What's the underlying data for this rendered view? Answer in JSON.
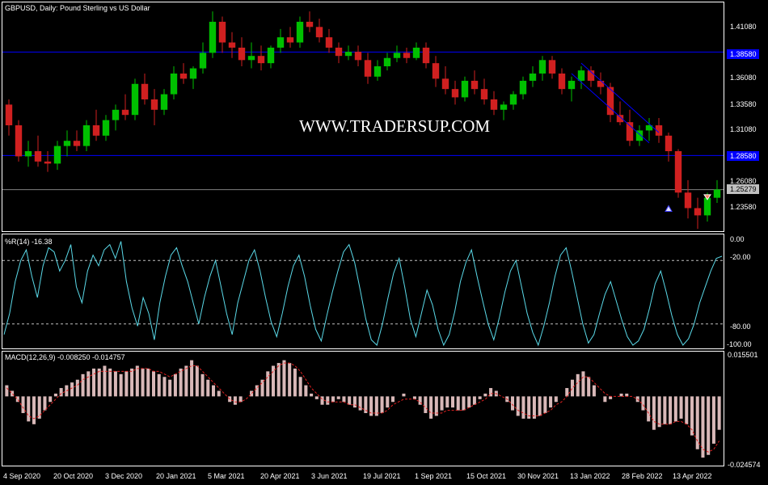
{
  "chart_data": {
    "type": "candlestick",
    "price_panel": {
      "title": "GBPUSD, Daily:  Pound Sterling vs US Dollar",
      "price_ticks": [
        "1.41080",
        "1.38580",
        "1.36080",
        "1.33580",
        "1.31080",
        "1.28580",
        "1.26080",
        "1.23580"
      ],
      "horizontal_levels": [
        {
          "label": "1.38580",
          "value": 1.3858,
          "color": "#0000ff"
        },
        {
          "label": "1.28580",
          "value": 1.2858,
          "color": "#0000ff"
        }
      ],
      "current_price": {
        "label": "1.25279",
        "value": 1.25279
      },
      "watermark": "WWW.TRADERSUP.COM",
      "ylim": [
        1.2135,
        1.4329
      ],
      "candles": [
        {
          "o": 1.335,
          "h": 1.34,
          "l": 1.305,
          "c": 1.315
        },
        {
          "o": 1.315,
          "h": 1.32,
          "l": 1.28,
          "c": 1.285
        },
        {
          "o": 1.285,
          "h": 1.3,
          "l": 1.275,
          "c": 1.29
        },
        {
          "o": 1.29,
          "h": 1.305,
          "l": 1.275,
          "c": 1.28
        },
        {
          "o": 1.28,
          "h": 1.29,
          "l": 1.27,
          "c": 1.278
        },
        {
          "o": 1.278,
          "h": 1.3,
          "l": 1.272,
          "c": 1.295
        },
        {
          "o": 1.295,
          "h": 1.31,
          "l": 1.285,
          "c": 1.3
        },
        {
          "o": 1.3,
          "h": 1.31,
          "l": 1.29,
          "c": 1.295
        },
        {
          "o": 1.295,
          "h": 1.32,
          "l": 1.29,
          "c": 1.315
        },
        {
          "o": 1.315,
          "h": 1.33,
          "l": 1.3,
          "c": 1.305
        },
        {
          "o": 1.305,
          "h": 1.325,
          "l": 1.3,
          "c": 1.32
        },
        {
          "o": 1.32,
          "h": 1.335,
          "l": 1.31,
          "c": 1.33
        },
        {
          "o": 1.33,
          "h": 1.345,
          "l": 1.32,
          "c": 1.325
        },
        {
          "o": 1.325,
          "h": 1.36,
          "l": 1.32,
          "c": 1.355
        },
        {
          "o": 1.355,
          "h": 1.365,
          "l": 1.335,
          "c": 1.34
        },
        {
          "o": 1.34,
          "h": 1.35,
          "l": 1.315,
          "c": 1.33
        },
        {
          "o": 1.33,
          "h": 1.35,
          "l": 1.325,
          "c": 1.345
        },
        {
          "o": 1.345,
          "h": 1.372,
          "l": 1.34,
          "c": 1.365
        },
        {
          "o": 1.365,
          "h": 1.375,
          "l": 1.355,
          "c": 1.36
        },
        {
          "o": 1.36,
          "h": 1.372,
          "l": 1.35,
          "c": 1.37
        },
        {
          "o": 1.37,
          "h": 1.395,
          "l": 1.365,
          "c": 1.385
        },
        {
          "o": 1.385,
          "h": 1.425,
          "l": 1.38,
          "c": 1.415
        },
        {
          "o": 1.415,
          "h": 1.42,
          "l": 1.385,
          "c": 1.395
        },
        {
          "o": 1.395,
          "h": 1.405,
          "l": 1.38,
          "c": 1.39
        },
        {
          "o": 1.39,
          "h": 1.4,
          "l": 1.372,
          "c": 1.378
        },
        {
          "o": 1.378,
          "h": 1.395,
          "l": 1.37,
          "c": 1.382
        },
        {
          "o": 1.382,
          "h": 1.392,
          "l": 1.368,
          "c": 1.375
        },
        {
          "o": 1.375,
          "h": 1.392,
          "l": 1.37,
          "c": 1.39
        },
        {
          "o": 1.39,
          "h": 1.408,
          "l": 1.385,
          "c": 1.4
        },
        {
          "o": 1.4,
          "h": 1.41,
          "l": 1.39,
          "c": 1.395
        },
        {
          "o": 1.395,
          "h": 1.42,
          "l": 1.39,
          "c": 1.415
        },
        {
          "o": 1.415,
          "h": 1.425,
          "l": 1.405,
          "c": 1.41
        },
        {
          "o": 1.41,
          "h": 1.418,
          "l": 1.395,
          "c": 1.4
        },
        {
          "o": 1.4,
          "h": 1.408,
          "l": 1.385,
          "c": 1.39
        },
        {
          "o": 1.39,
          "h": 1.395,
          "l": 1.375,
          "c": 1.382
        },
        {
          "o": 1.382,
          "h": 1.392,
          "l": 1.378,
          "c": 1.386
        },
        {
          "o": 1.386,
          "h": 1.392,
          "l": 1.372,
          "c": 1.378
        },
        {
          "o": 1.378,
          "h": 1.385,
          "l": 1.355,
          "c": 1.362
        },
        {
          "o": 1.362,
          "h": 1.378,
          "l": 1.358,
          "c": 1.372
        },
        {
          "o": 1.372,
          "h": 1.385,
          "l": 1.368,
          "c": 1.38
        },
        {
          "o": 1.38,
          "h": 1.392,
          "l": 1.376,
          "c": 1.385
        },
        {
          "o": 1.385,
          "h": 1.39,
          "l": 1.375,
          "c": 1.38
        },
        {
          "o": 1.38,
          "h": 1.395,
          "l": 1.378,
          "c": 1.39
        },
        {
          "o": 1.39,
          "h": 1.395,
          "l": 1.37,
          "c": 1.375
        },
        {
          "o": 1.375,
          "h": 1.382,
          "l": 1.352,
          "c": 1.36
        },
        {
          "o": 1.36,
          "h": 1.372,
          "l": 1.345,
          "c": 1.35
        },
        {
          "o": 1.35,
          "h": 1.358,
          "l": 1.335,
          "c": 1.342
        },
        {
          "o": 1.342,
          "h": 1.362,
          "l": 1.338,
          "c": 1.358
        },
        {
          "o": 1.358,
          "h": 1.368,
          "l": 1.345,
          "c": 1.35
        },
        {
          "o": 1.35,
          "h": 1.36,
          "l": 1.335,
          "c": 1.34
        },
        {
          "o": 1.34,
          "h": 1.348,
          "l": 1.325,
          "c": 1.33
        },
        {
          "o": 1.33,
          "h": 1.338,
          "l": 1.32,
          "c": 1.335
        },
        {
          "o": 1.335,
          "h": 1.348,
          "l": 1.33,
          "c": 1.345
        },
        {
          "o": 1.345,
          "h": 1.362,
          "l": 1.34,
          "c": 1.358
        },
        {
          "o": 1.358,
          "h": 1.372,
          "l": 1.352,
          "c": 1.365
        },
        {
          "o": 1.365,
          "h": 1.382,
          "l": 1.358,
          "c": 1.378
        },
        {
          "o": 1.378,
          "h": 1.382,
          "l": 1.36,
          "c": 1.365
        },
        {
          "o": 1.365,
          "h": 1.37,
          "l": 1.345,
          "c": 1.35
        },
        {
          "o": 1.35,
          "h": 1.362,
          "l": 1.338,
          "c": 1.358
        },
        {
          "o": 1.358,
          "h": 1.372,
          "l": 1.35,
          "c": 1.368
        },
        {
          "o": 1.368,
          "h": 1.372,
          "l": 1.352,
          "c": 1.358
        },
        {
          "o": 1.358,
          "h": 1.366,
          "l": 1.345,
          "c": 1.352
        },
        {
          "o": 1.352,
          "h": 1.356,
          "l": 1.318,
          "c": 1.325
        },
        {
          "o": 1.325,
          "h": 1.338,
          "l": 1.315,
          "c": 1.318
        },
        {
          "o": 1.318,
          "h": 1.33,
          "l": 1.295,
          "c": 1.3
        },
        {
          "o": 1.3,
          "h": 1.315,
          "l": 1.295,
          "c": 1.31
        },
        {
          "o": 1.31,
          "h": 1.322,
          "l": 1.3,
          "c": 1.315
        },
        {
          "o": 1.315,
          "h": 1.322,
          "l": 1.298,
          "c": 1.305
        },
        {
          "o": 1.305,
          "h": 1.308,
          "l": 1.28,
          "c": 1.29
        },
        {
          "o": 1.29,
          "h": 1.292,
          "l": 1.245,
          "c": 1.25
        },
        {
          "o": 1.25,
          "h": 1.262,
          "l": 1.225,
          "c": 1.235
        },
        {
          "o": 1.235,
          "h": 1.245,
          "l": 1.215,
          "c": 1.228
        },
        {
          "o": 1.228,
          "h": 1.25,
          "l": 1.222,
          "c": 1.245
        },
        {
          "o": 1.245,
          "h": 1.262,
          "l": 1.24,
          "c": 1.253
        }
      ]
    },
    "williams_r": {
      "label": "%R(14) -16.38",
      "axis_labels": [
        "0.00",
        "-20.00",
        "-80.00",
        "-100.00"
      ],
      "levels": [
        -20,
        -80
      ],
      "ylim": [
        -100,
        0
      ],
      "values": [
        -90,
        -70,
        -40,
        -20,
        -10,
        -35,
        -55,
        -25,
        -8,
        -12,
        -30,
        -20,
        -5,
        -45,
        -60,
        -30,
        -15,
        -25,
        -10,
        -5,
        -18,
        -2,
        -40,
        -65,
        -82,
        -55,
        -70,
        -95,
        -60,
        -35,
        -15,
        -8,
        -25,
        -40,
        -60,
        -80,
        -55,
        -35,
        -20,
        -45,
        -70,
        -90,
        -60,
        -40,
        -20,
        -10,
        -30,
        -55,
        -78,
        -92,
        -70,
        -45,
        -25,
        -15,
        -35,
        -62,
        -85,
        -96,
        -72,
        -50,
        -30,
        -12,
        -5,
        -22,
        -48,
        -75,
        -95,
        -100,
        -80,
        -55,
        -32,
        -18,
        -45,
        -75,
        -92,
        -70,
        -48,
        -62,
        -85,
        -100,
        -90,
        -68,
        -40,
        -22,
        -10,
        -35,
        -58,
        -80,
        -95,
        -74,
        -50,
        -30,
        -20,
        -45,
        -70,
        -88,
        -100,
        -82,
        -60,
        -35,
        -15,
        -8,
        -30,
        -55,
        -80,
        -98,
        -90,
        -70,
        -52,
        -40,
        -58,
        -76,
        -92,
        -100,
        -96,
        -85,
        -65,
        -42,
        -30,
        -50,
        -72,
        -90,
        -100,
        -94,
        -80,
        -60,
        -45,
        -30,
        -18,
        -16
      ]
    },
    "macd": {
      "label": "MACD(12,26,9) -0.008250 -0.014757",
      "axis_labels": [
        "0.015501",
        "-0.024574"
      ],
      "ylim": [
        -0.024574,
        0.015501
      ],
      "histogram": [
        0.004,
        0.002,
        -0.002,
        -0.006,
        -0.009,
        -0.01,
        -0.008,
        -0.005,
        -0.002,
        0.001,
        0.003,
        0.004,
        0.005,
        0.006,
        0.008,
        0.009,
        0.01,
        0.01,
        0.011,
        0.01,
        0.009,
        0.008,
        0.009,
        0.01,
        0.011,
        0.01,
        0.01,
        0.009,
        0.008,
        0.007,
        0.006,
        0.008,
        0.01,
        0.011,
        0.013,
        0.011,
        0.008,
        0.006,
        0.004,
        0.002,
        0.0,
        -0.002,
        -0.003,
        -0.002,
        0.0,
        0.002,
        0.004,
        0.006,
        0.009,
        0.011,
        0.012,
        0.013,
        0.012,
        0.01,
        0.007,
        0.004,
        0.001,
        -0.001,
        -0.003,
        -0.003,
        -0.002,
        -0.001,
        -0.002,
        -0.003,
        -0.004,
        -0.005,
        -0.006,
        -0.007,
        -0.007,
        -0.006,
        -0.004,
        -0.002,
        0.0,
        0.001,
        0.0,
        -0.001,
        -0.003,
        -0.006,
        -0.008,
        -0.007,
        -0.005,
        -0.004,
        -0.004,
        -0.005,
        -0.005,
        -0.004,
        -0.003,
        -0.001,
        0.001,
        0.003,
        0.002,
        0.0,
        -0.002,
        -0.005,
        -0.007,
        -0.008,
        -0.008,
        -0.008,
        -0.007,
        -0.006,
        -0.004,
        -0.002,
        0.0,
        0.003,
        0.006,
        0.008,
        0.009,
        0.007,
        0.004,
        0.0,
        -0.002,
        -0.001,
        0.0,
        0.001,
        0.001,
        0.0,
        -0.002,
        -0.005,
        -0.009,
        -0.012,
        -0.011,
        -0.01,
        -0.01,
        -0.009,
        -0.008,
        -0.01,
        -0.014,
        -0.019,
        -0.022,
        -0.021,
        -0.017,
        -0.012
      ],
      "signal": [
        0.003,
        0.001,
        -0.001,
        -0.004,
        -0.007,
        -0.008,
        -0.007,
        -0.005,
        -0.003,
        -0.001,
        0.001,
        0.002,
        0.003,
        0.004,
        0.006,
        0.007,
        0.008,
        0.009,
        0.009,
        0.009,
        0.009,
        0.009,
        0.009,
        0.009,
        0.01,
        0.01,
        0.01,
        0.009,
        0.009,
        0.008,
        0.007,
        0.008,
        0.009,
        0.01,
        0.011,
        0.011,
        0.009,
        0.007,
        0.005,
        0.003,
        0.001,
        -0.001,
        -0.002,
        -0.002,
        -0.001,
        0.001,
        0.003,
        0.005,
        0.007,
        0.009,
        0.011,
        0.012,
        0.012,
        0.011,
        0.009,
        0.006,
        0.003,
        0.001,
        -0.001,
        -0.002,
        -0.002,
        -0.002,
        -0.002,
        -0.003,
        -0.003,
        -0.004,
        -0.005,
        -0.006,
        -0.006,
        -0.006,
        -0.005,
        -0.003,
        -0.002,
        -0.001,
        -0.001,
        -0.001,
        -0.002,
        -0.004,
        -0.006,
        -0.006,
        -0.006,
        -0.005,
        -0.005,
        -0.005,
        -0.005,
        -0.004,
        -0.003,
        -0.002,
        -0.001,
        0.001,
        0.001,
        0.0,
        -0.001,
        -0.003,
        -0.005,
        -0.006,
        -0.007,
        -0.007,
        -0.007,
        -0.006,
        -0.005,
        -0.003,
        -0.002,
        0.0,
        0.003,
        0.005,
        0.007,
        0.007,
        0.005,
        0.003,
        0.001,
        0.0,
        0.0,
        0.0,
        0.0,
        0.0,
        -0.001,
        -0.003,
        -0.006,
        -0.009,
        -0.01,
        -0.01,
        -0.01,
        -0.009,
        -0.009,
        -0.01,
        -0.012,
        -0.016,
        -0.019,
        -0.02,
        -0.019,
        -0.016
      ]
    },
    "date_labels": [
      "4 Sep 2020",
      "20 Oct 2020",
      "3 Dec 2020",
      "20 Jan 2021",
      "5 Mar 2021",
      "20 Apr 2021",
      "3 Jun 2021",
      "19 Jul 2021",
      "1 Sep 2021",
      "15 Oct 2021",
      "30 Nov 2021",
      "13 Jan 2022",
      "28 Feb 2022",
      "13 Apr 2022"
    ],
    "colors": {
      "background": "#000000",
      "frame": "#ffffff",
      "bull_candle": "#00c000",
      "bear_candle": "#d02020",
      "level_line": "#0000ff",
      "current_price_line": "#808080",
      "williams_line": "#5ad9e8",
      "macd_hist": "#d8b8b8",
      "macd_signal": "#e02020",
      "trendline": "#0000ff"
    }
  }
}
